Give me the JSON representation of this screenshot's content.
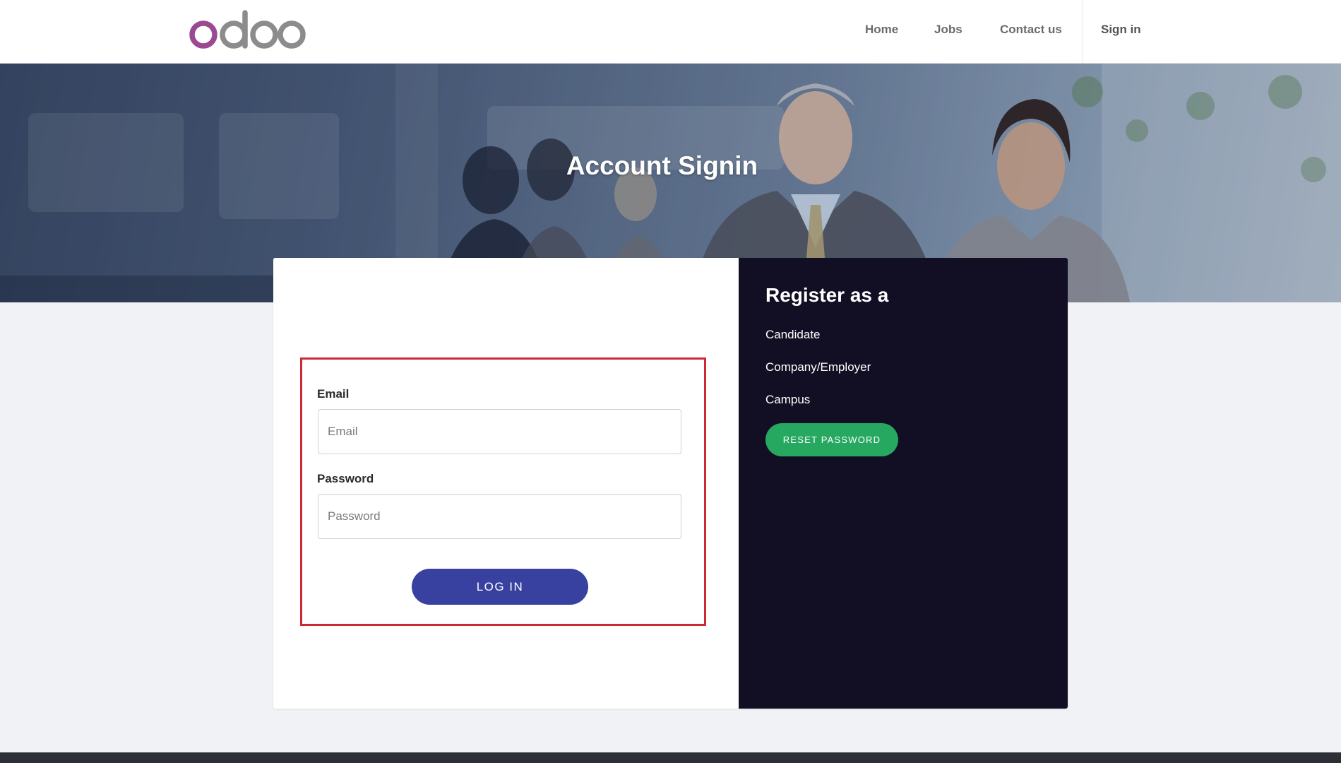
{
  "brand": {
    "name": "odoo",
    "colors": {
      "primary_o": "#9b4a91",
      "rest": "#8c8c8c"
    }
  },
  "nav": {
    "items": [
      {
        "label": "Home"
      },
      {
        "label": "Jobs"
      },
      {
        "label": "Contact us"
      }
    ],
    "signin_label": "Sign in"
  },
  "hero": {
    "title": "Account Signin"
  },
  "login": {
    "email_label": "Email",
    "email_placeholder": "Email",
    "email_value": "",
    "password_label": "Password",
    "password_placeholder": "Password",
    "password_value": "",
    "submit_label": "LOG IN"
  },
  "register": {
    "title": "Register as a",
    "options": [
      {
        "label": "Candidate"
      },
      {
        "label": "Company/Employer"
      },
      {
        "label": "Campus"
      }
    ],
    "reset_label": "RESET PASSWORD"
  },
  "colors": {
    "login_button": "#3840a0",
    "reset_button": "#27a861",
    "register_bg": "#120f24",
    "highlight_border": "#cc2b33",
    "page_bg": "#f0f2f5"
  }
}
